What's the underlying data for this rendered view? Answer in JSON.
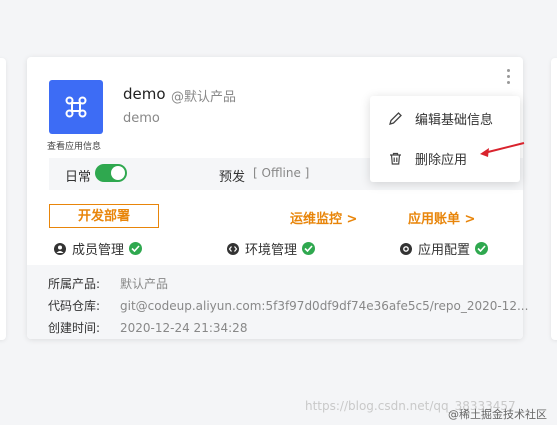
{
  "card": {
    "app_name": "demo",
    "app_product": "@默认产品",
    "app_subtitle": "demo",
    "view_app_info": "查看应用信息",
    "env": {
      "daily": "日常",
      "pre": "预发",
      "pre_status": "[ Offline ]"
    },
    "actions": {
      "deploy": "开发部署",
      "monitor": "运维监控 >",
      "bill": "应用账单 >"
    },
    "features": [
      {
        "label": "成员管理",
        "icon": "user-icon"
      },
      {
        "label": "环境管理",
        "icon": "code-icon"
      },
      {
        "label": "应用配置",
        "icon": "gear-icon"
      }
    ],
    "details": [
      {
        "label": "所属产品:",
        "value": "默认产品"
      },
      {
        "label": "代码仓库:",
        "value": "git@codeup.aliyun.com:5f3f97d0df9df74e36afe5c5/repo_2020-12..."
      },
      {
        "label": "创建时间:",
        "value": "2020-12-24 21:34:28"
      }
    ]
  },
  "menu": {
    "items": [
      {
        "label": "编辑基础信息",
        "icon": "pencil-icon"
      },
      {
        "label": "删除应用",
        "icon": "trash-icon"
      }
    ]
  },
  "watermark": {
    "url": "https://blog.csdn.net/qq_38333457",
    "brand": "@稀土掘金技术社区"
  },
  "colors": {
    "accent": "#3d6cf5",
    "orange": "#e8850a",
    "green": "#2fa84f",
    "arrow": "#d9232d"
  }
}
